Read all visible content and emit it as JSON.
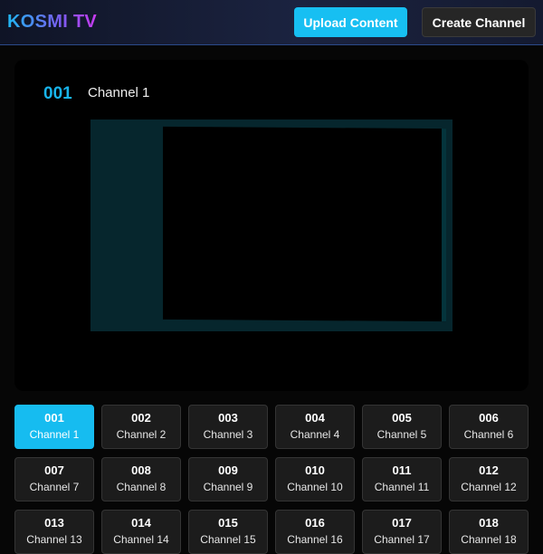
{
  "header": {
    "logo": "KOSMI TV",
    "upload_label": "Upload Content",
    "create_label": "Create Channel"
  },
  "player": {
    "channel_number": "001",
    "channel_name": "Channel 1"
  },
  "colors": {
    "accent": "#17bff2",
    "logo_gradient": [
      "#1fb6f2",
      "#7b5cf0",
      "#c93af0"
    ]
  },
  "channels": [
    {
      "number": "001",
      "name": "Channel 1",
      "active": true
    },
    {
      "number": "002",
      "name": "Channel 2"
    },
    {
      "number": "003",
      "name": "Channel 3"
    },
    {
      "number": "004",
      "name": "Channel 4"
    },
    {
      "number": "005",
      "name": "Channel 5"
    },
    {
      "number": "006",
      "name": "Channel 6"
    },
    {
      "number": "007",
      "name": "Channel 7"
    },
    {
      "number": "008",
      "name": "Channel 8"
    },
    {
      "number": "009",
      "name": "Channel 9"
    },
    {
      "number": "010",
      "name": "Channel 10"
    },
    {
      "number": "011",
      "name": "Channel 11"
    },
    {
      "number": "012",
      "name": "Channel 12"
    },
    {
      "number": "013",
      "name": "Channel 13"
    },
    {
      "number": "014",
      "name": "Channel 14"
    },
    {
      "number": "015",
      "name": "Channel 15"
    },
    {
      "number": "016",
      "name": "Channel 16"
    },
    {
      "number": "017",
      "name": "Channel 17"
    },
    {
      "number": "018",
      "name": "Channel 18"
    }
  ]
}
